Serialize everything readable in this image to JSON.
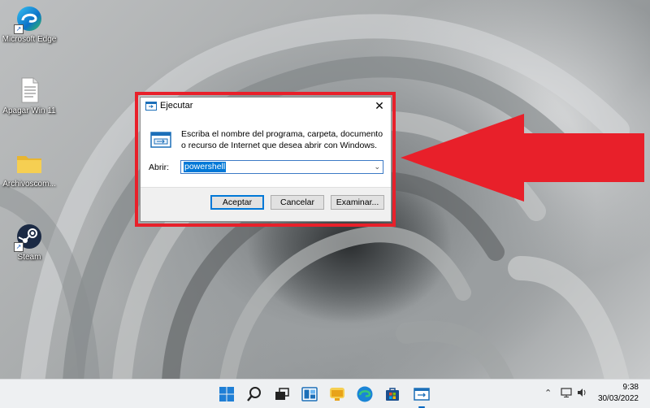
{
  "desktop": {
    "icons": [
      {
        "label": "Microsoft Edge"
      },
      {
        "label": "Apagar Win 11"
      },
      {
        "label": "Archivoscom..."
      },
      {
        "label": "Steam"
      }
    ]
  },
  "run_dialog": {
    "title": "Ejecutar",
    "close_glyph": "✕",
    "description": "Escriba el nombre del programa, carpeta, documento o recurso de Internet que desea abrir con Windows.",
    "open_label": "Abrir:",
    "open_value": "powershell",
    "dropdown_glyph": "⌄",
    "buttons": {
      "ok": "Aceptar",
      "cancel": "Cancelar",
      "browse": "Examinar..."
    }
  },
  "annotation": {
    "frame_color": "#e8202a",
    "arrow_color": "#e8202a"
  },
  "taskbar": {
    "icons": [
      "start-icon",
      "search-icon",
      "task-view-icon",
      "widgets-icon",
      "chat-icon",
      "edge-icon",
      "store-icon",
      "run-icon"
    ],
    "clock_time": "9:38",
    "clock_date": "30/03/2022"
  },
  "colors": {
    "accent": "#0078d7",
    "highlight_red": "#e8202a"
  }
}
